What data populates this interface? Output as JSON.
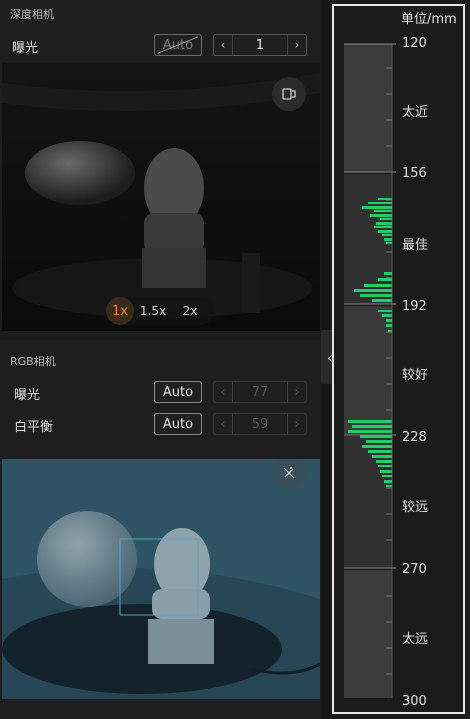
{
  "depth_camera": {
    "title": "深度相机",
    "exposure_label": "曝光",
    "auto_label": "Auto",
    "exposure_value": "1",
    "zoom_options": [
      "1x",
      "1.5x",
      "2x"
    ],
    "zoom_selected": "1x"
  },
  "rgb_camera": {
    "title": "RGB相机",
    "exposure_label": "曝光",
    "exposure_auto_label": "Auto",
    "exposure_value": "77",
    "white_balance_label": "白平衡",
    "white_balance_auto_label": "Auto",
    "white_balance_value": "59"
  },
  "collapse_arrow": "‹",
  "depth_scale": {
    "unit_label": "单位/mm",
    "ticks": [
      "120",
      "156",
      "192",
      "228",
      "270",
      "300"
    ],
    "zones": [
      "太近",
      "最佳",
      "较好",
      "较远",
      "太远"
    ],
    "accent_color": "#22cc66"
  }
}
